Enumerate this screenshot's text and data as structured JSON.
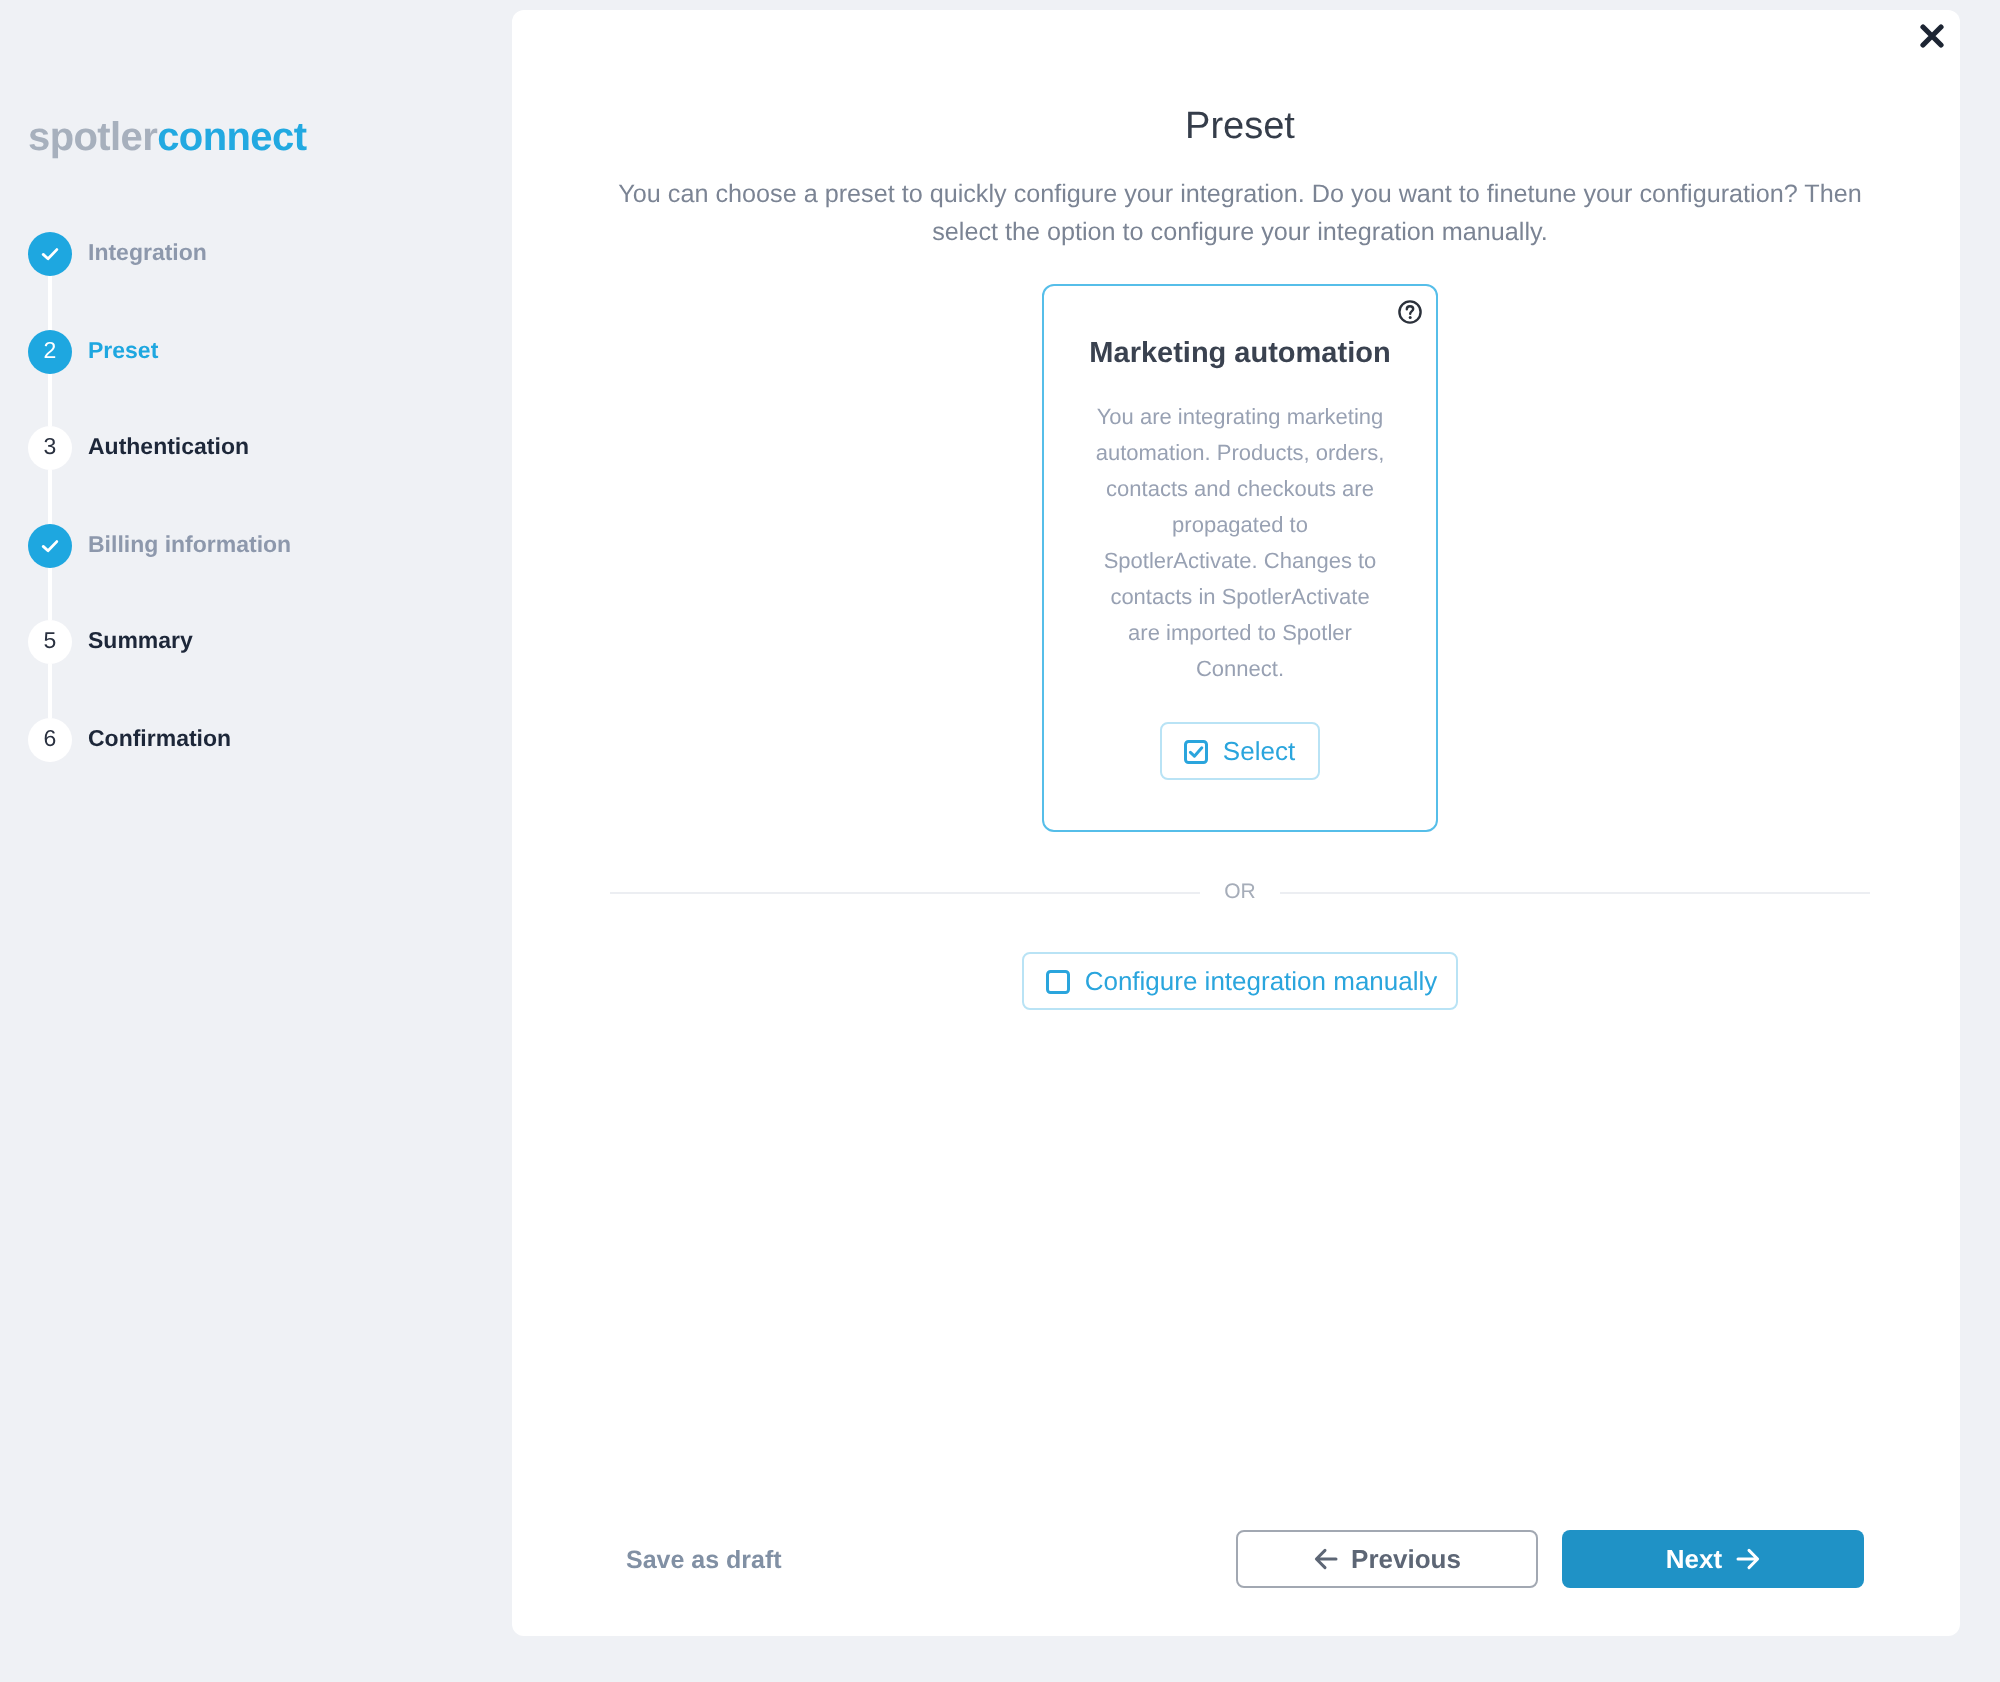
{
  "logo": {
    "text": "spotler",
    "accent": "connect"
  },
  "steps": [
    {
      "label": "Integration",
      "completed": true,
      "selected": false
    },
    {
      "number": "2",
      "label": "Preset",
      "completed": false,
      "selected": true
    },
    {
      "number": "3",
      "label": "Authentication",
      "completed": false,
      "selected": false
    },
    {
      "label": "Billing information",
      "completed": true,
      "selected": false
    },
    {
      "number": "5",
      "label": "Summary",
      "completed": false,
      "selected": false
    },
    {
      "number": "6",
      "label": "Confirmation",
      "completed": false,
      "selected": false
    }
  ],
  "title": "Preset",
  "intro": "You can choose a preset to quickly configure your integration. Do you want to finetune your configuration? Then select the option to configure your integration manually.",
  "presets": [
    {
      "title": "Marketing automation",
      "description": "You are integrating marketing automation. Products, orders, contacts and checkouts are propagated to SpotlerActivate. Changes to contacts in SpotlerActivate are imported to Spotler Connect.",
      "button": {
        "label": "Select",
        "checked": true
      }
    }
  ],
  "divider_label": "OR",
  "manual_button": {
    "label": "Configure integration manually",
    "checked": false
  },
  "footer": {
    "draft": "Save as draft",
    "previous": "Previous",
    "next": "Next"
  }
}
